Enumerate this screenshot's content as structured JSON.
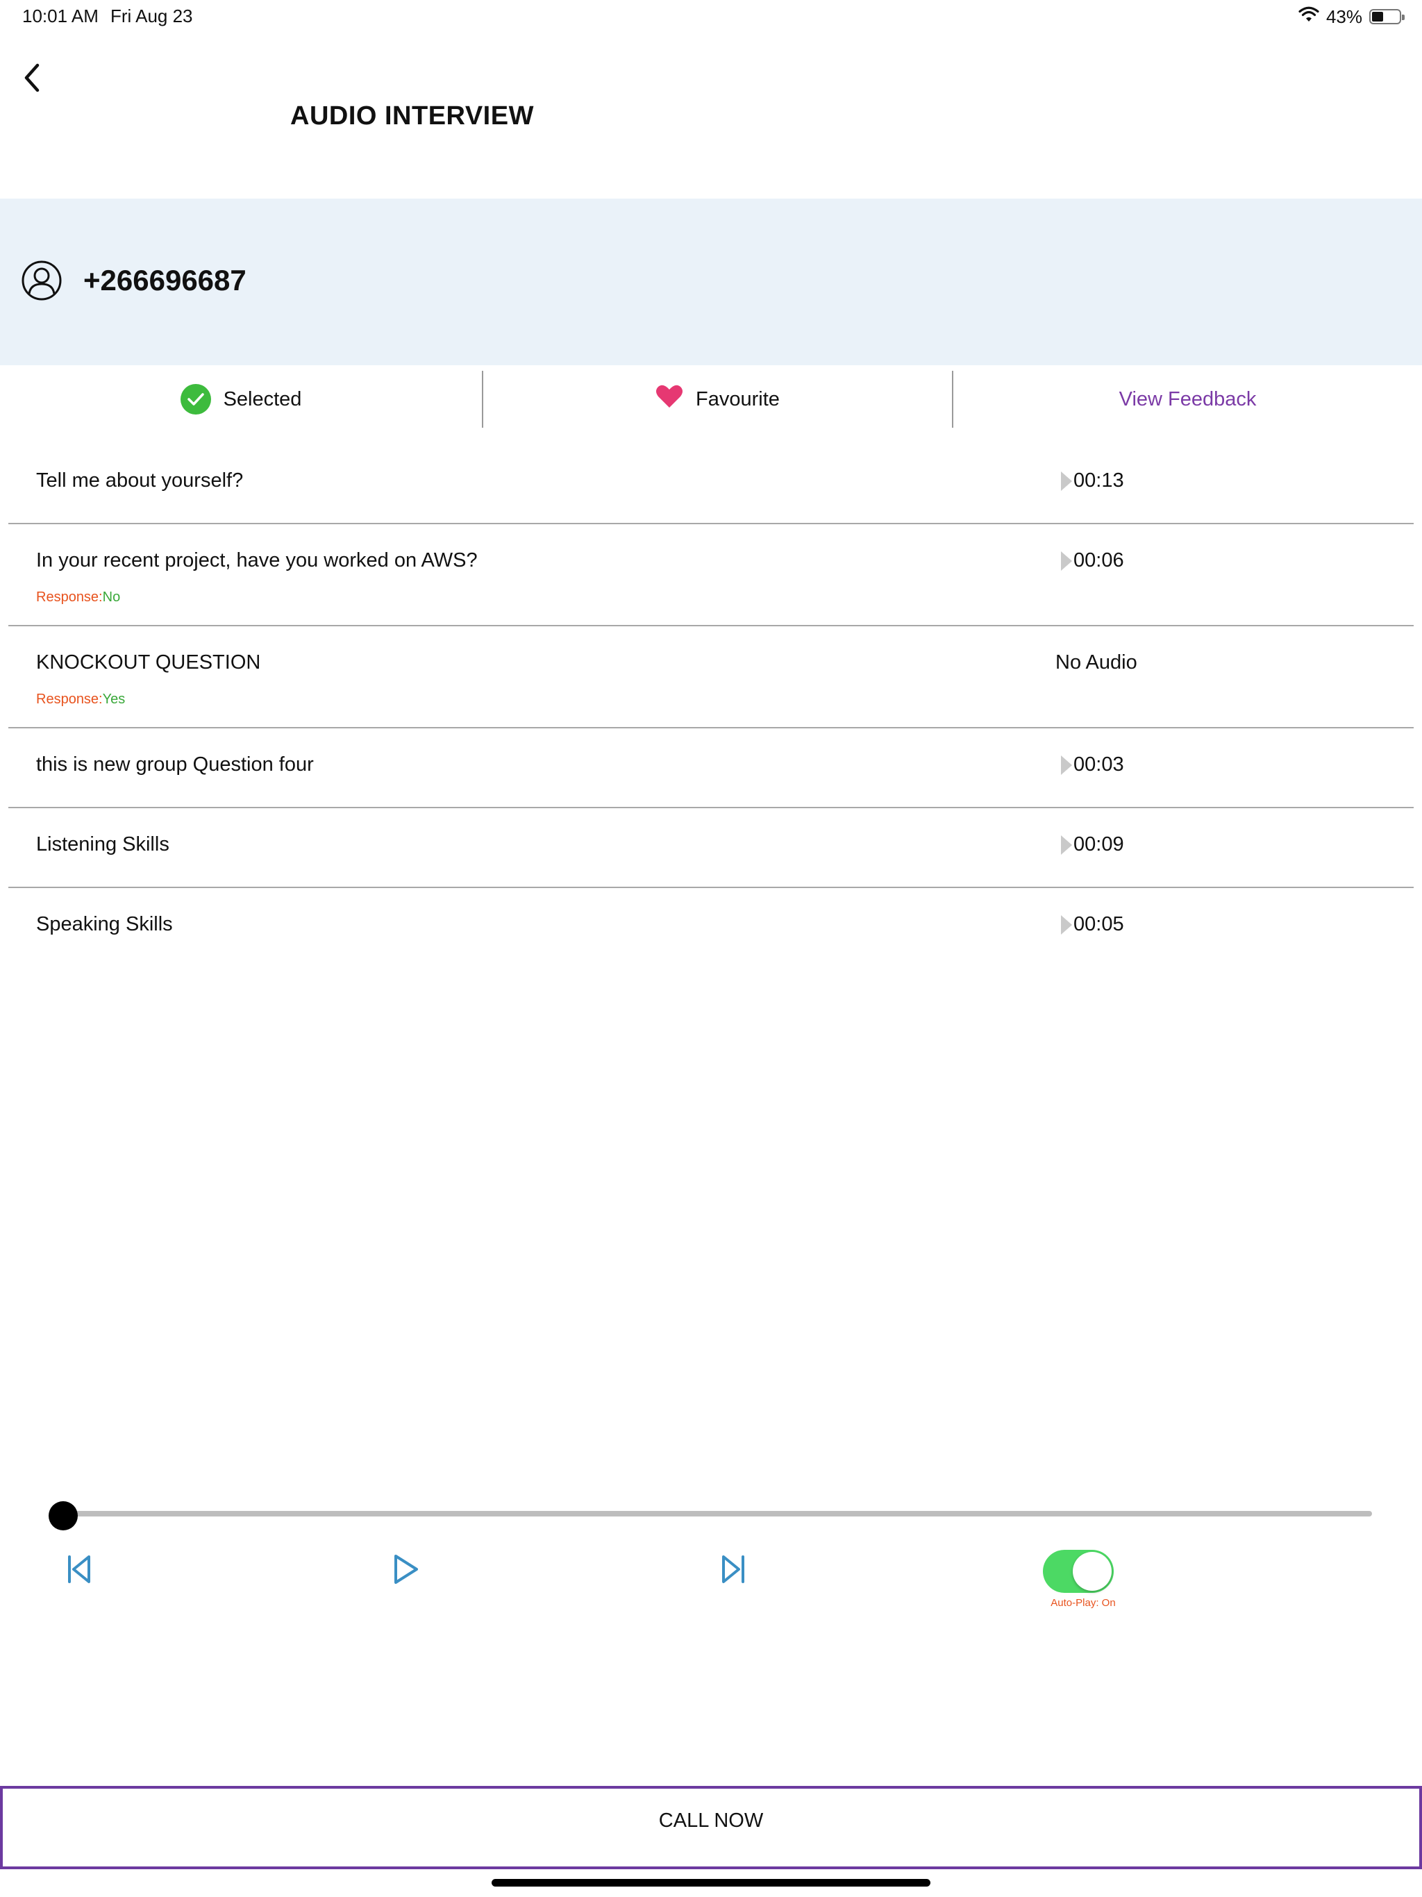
{
  "status_bar": {
    "time": "10:01 AM",
    "date": "Fri Aug 23",
    "battery_text": "43%",
    "battery_level": 0.43,
    "wifi_icon": "wifi-icon"
  },
  "header": {
    "back_icon": "chevron-left-icon",
    "title": "AUDIO INTERVIEW"
  },
  "candidate": {
    "avatar_icon": "user-icon",
    "phone": "+266696687"
  },
  "actions": {
    "selected_label": "Selected",
    "favourite_label": "Favourite",
    "feedback_label": "View Feedback"
  },
  "questions": [
    {
      "text": "Tell me about yourself?",
      "duration": "00:13"
    },
    {
      "text": "In your recent project, have you worked on AWS?",
      "response_label": "Response:",
      "response_value": "No",
      "duration": "00:06"
    },
    {
      "text": "KNOCKOUT QUESTION",
      "response_label": "Response:",
      "response_value": "Yes",
      "duration": "No Audio"
    },
    {
      "text": "this is new group Question four",
      "duration": "00:03"
    },
    {
      "text": "Listening Skills",
      "duration": "00:09"
    },
    {
      "text": "Speaking Skills",
      "duration": "00:05"
    }
  ],
  "player": {
    "progress": 0,
    "prev_icon": "skip-previous-icon",
    "play_icon": "play-icon",
    "next_icon": "skip-next-icon",
    "autoplay_on": true,
    "autoplay_label": "Auto-Play: On"
  },
  "call_button": {
    "label": "CALL NOW"
  },
  "colors": {
    "banner_bg": "#eaf2f9",
    "accent_purple": "#7b3aa6",
    "selected_green": "#3dbb3d",
    "heart_pink": "#e63872",
    "response_orange": "#e8531e",
    "response_green": "#3aa83a",
    "toggle_green": "#4cd964",
    "control_blue": "#3a8fc4"
  }
}
